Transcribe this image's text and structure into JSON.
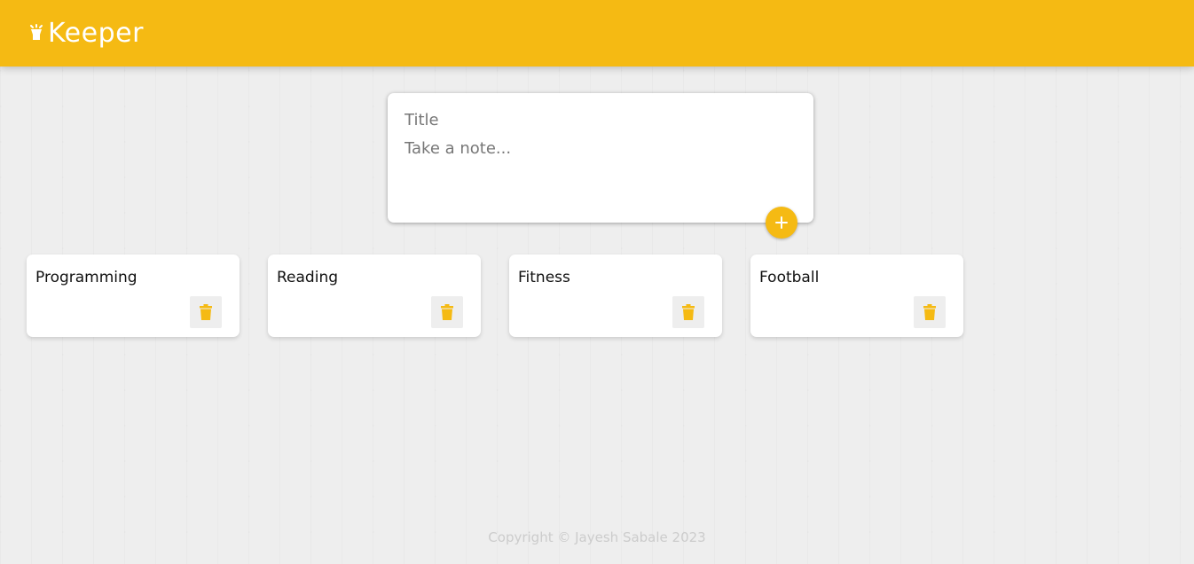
{
  "header": {
    "brand_icon": "lightbulb-icon",
    "title": "Keeper"
  },
  "composer": {
    "title_placeholder": "Title",
    "body_placeholder": "Take a note...",
    "add_icon": "plus-icon"
  },
  "notes": [
    {
      "title": "Programming",
      "delete_icon": "trash-icon"
    },
    {
      "title": "Reading",
      "delete_icon": "trash-icon"
    },
    {
      "title": "Fitness",
      "delete_icon": "trash-icon"
    },
    {
      "title": "Football",
      "delete_icon": "trash-icon"
    }
  ],
  "footer": {
    "text": "Copyright © Jayesh Sabale 2023"
  },
  "colors": {
    "accent": "#f5ba13",
    "background": "#eeeeee",
    "card": "#ffffff",
    "footer_text": "#cccccc"
  }
}
